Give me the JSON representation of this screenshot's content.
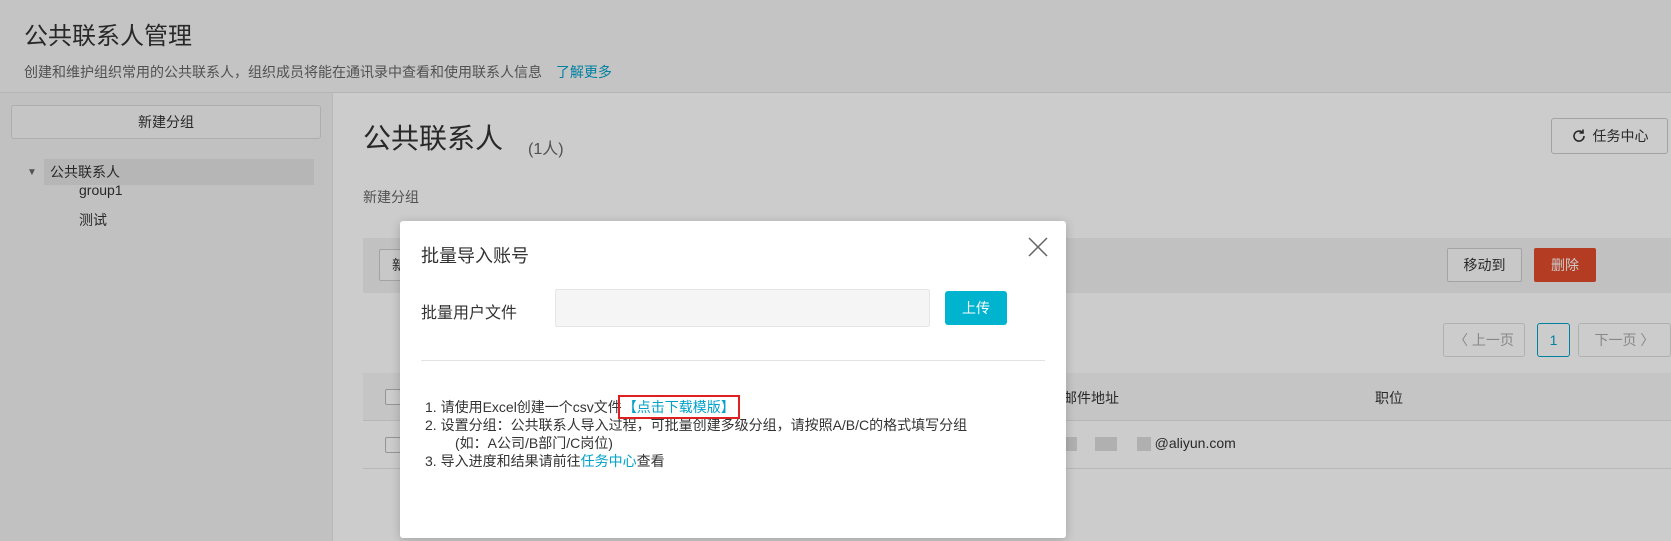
{
  "header": {
    "title": "公共联系人管理",
    "description": "创建和维护组织常用的公共联系人，组织成员将能在通讯录中查看和使用联系人信息",
    "learn_more": "了解更多"
  },
  "sidebar": {
    "new_group_button": "新建分组",
    "tree": {
      "root": "公共联系人",
      "children": [
        "group1",
        "测试"
      ]
    }
  },
  "main": {
    "title": "公共联系人",
    "count": "(1人)",
    "task_center_button": "任务中心",
    "new_group_link": "新建分组",
    "toolbar": {
      "left_button_partial": "新",
      "move_button": "移动到",
      "delete_button": "删除"
    },
    "pagination": {
      "prev": "〈 上一页",
      "current": "1",
      "next": "下一页 〉"
    },
    "table": {
      "headers": {
        "email": "邮件地址",
        "position": "职位"
      },
      "rows": [
        {
          "email": "@aliyun.com",
          "position": ""
        }
      ]
    }
  },
  "modal": {
    "title": "批量导入账号",
    "field_label": "批量用户文件",
    "field_value": "",
    "upload_button": "上传",
    "steps": {
      "step1_text": "1. 请使用Excel创建一个csv文件",
      "step1_link": "【点击下载模版】",
      "step2_text": "2. 设置分组：公共联系人导入过程，可批量创建多级分组，请按照A/B/C的格式填写分组",
      "step2_example": "(如：A公司/B部门/C岗位)",
      "step3_prefix": "3. 导入进度和结果请前往",
      "step3_link": "任务中心",
      "step3_suffix": "查看"
    }
  },
  "colors": {
    "accent": "#00a2ca",
    "upload": "#00b4cf",
    "danger": "#e04b2b",
    "highlight_box": "#e02020"
  }
}
